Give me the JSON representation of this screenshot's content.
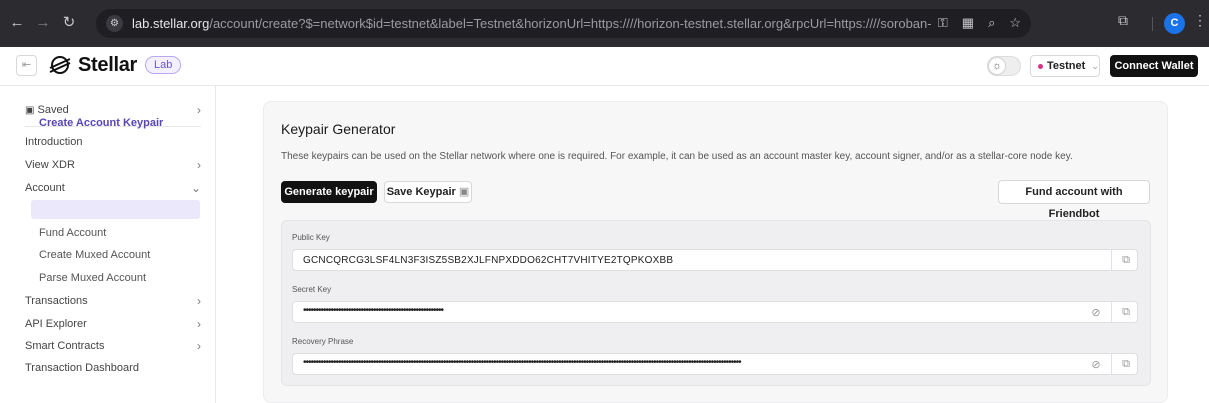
{
  "browser": {
    "url_host": "lab.stellar.org",
    "url_rest": "/account/create?$=network$id=testnet&label=Testnet&horizonUrl=https:////horizon-testnet.stellar.org&rpcUrl=https:////soroban-testnet.stellar.org&passphrase=...",
    "profile_initial": "C"
  },
  "header": {
    "logo_text": "Stellar",
    "badge": "Lab",
    "network_label": "Testnet",
    "connect_label": "Connect Wallet"
  },
  "sidebar": {
    "saved": "Saved",
    "introduction": "Introduction",
    "view_xdr": "View XDR",
    "account": "Account",
    "account_items": [
      "Create Account Keypair",
      "Fund Account",
      "Create Muxed Account",
      "Parse Muxed Account"
    ],
    "transactions": "Transactions",
    "api_explorer": "API Explorer",
    "smart_contracts": "Smart Contracts",
    "transaction_dashboard": "Transaction Dashboard"
  },
  "main": {
    "title": "Keypair Generator",
    "description": "These keypairs can be used on the Stellar network where one is required. For example, it can be used as an account master key, account signer, and/or as a stellar-core node key.",
    "generate_label": "Generate keypair",
    "save_label": "Save Keypair",
    "fund_label": "Fund account with Friendbot",
    "public_key_label": "Public Key",
    "public_key_value": "GCNCQRCG3LSF4LN3F3ISZ5SB2XJLFNPXDDO62CHT7VHITYE2TQPKOXBB",
    "secret_key_label": "Secret Key",
    "secret_key_value": "••••••••••••••••••••••••••••••••••••••••••••••••••••••••",
    "recovery_label": "Recovery Phrase",
    "recovery_value": "•••••••••••••••••••••••••••••••••••••••••••••••••••••••••••••••••••••••••••••••••••••••••••••••••••••••••••••••••••••••••••••••••••••••••••••••••••••••••••••••••••••••••••••••"
  }
}
